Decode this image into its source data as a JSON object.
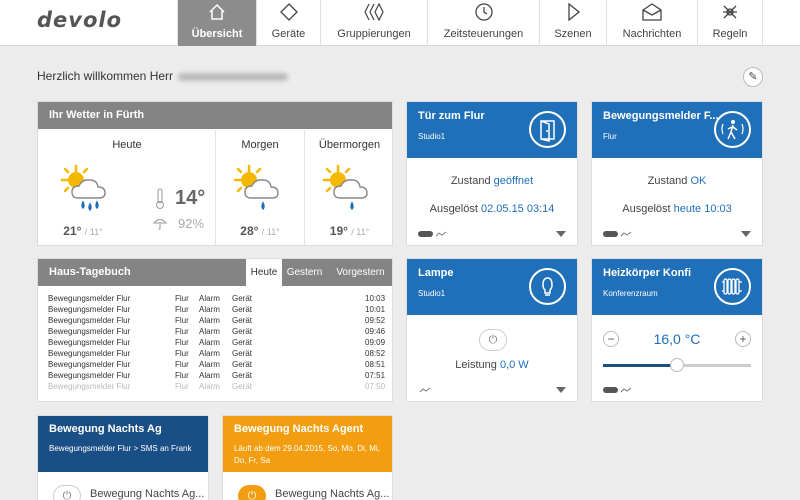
{
  "brand": {
    "logo": "devolo"
  },
  "nav": {
    "tabs": [
      {
        "label": "Übersicht",
        "icon": "home-icon"
      },
      {
        "label": "Geräte",
        "icon": "diamond-icon"
      },
      {
        "label": "Gruppierungen",
        "icon": "groups-icon"
      },
      {
        "label": "Zeitsteuerungen",
        "icon": "clock-icon"
      },
      {
        "label": "Szenen",
        "icon": "play-icon"
      },
      {
        "label": "Nachrichten",
        "icon": "envelope-icon"
      },
      {
        "label": "Regeln",
        "icon": "rules-icon"
      }
    ],
    "active_index": 0
  },
  "greeting": {
    "text": "Herzlich willkommen Herr"
  },
  "weather": {
    "title": "Ihr Wetter in Fürth",
    "days": [
      {
        "label": "Heute",
        "icon": "sun-cloud-rain-icon",
        "temp": "21°",
        "low": "/ 11°"
      },
      {
        "label": "Morgen",
        "icon": "sun-cloud-rain-icon",
        "temp": "28°",
        "low": "/ 11°"
      },
      {
        "label": "Übermorgen",
        "icon": "sun-cloud-rain-icon",
        "temp": "19°",
        "low": "/ 11°"
      }
    ],
    "current_temp": "14°",
    "humidity": "92%"
  },
  "tiles": {
    "door": {
      "title": "Tür zum Flur",
      "subtitle": "Studio1",
      "state_label": "Zustand",
      "state_value": "geöffnet",
      "trigger_label": "Ausgelöst",
      "trigger_value": "02.05.15 03:14",
      "icon": "door-icon"
    },
    "motion": {
      "title": "Bewegungsmelder F...",
      "subtitle": "Flur",
      "state_label": "Zustand",
      "state_value": "OK",
      "trigger_label": "Ausgelöst",
      "trigger_value": "heute 10:03",
      "icon": "motion-person-icon"
    },
    "lamp": {
      "title": "Lampe",
      "subtitle": "Studio1",
      "power_label": "Leistung",
      "power_value": "0,0 W",
      "icon": "bulb-icon"
    },
    "heater": {
      "title": "Heizkörper Konfi",
      "subtitle": "Konferenzraum",
      "setpoint": "16,0 °C",
      "slider_fraction": 0.5,
      "icon": "radiator-icon"
    }
  },
  "diary": {
    "title": "Haus-Tagebuch",
    "tabs": [
      "Heute",
      "Gestern",
      "Vorgestern"
    ],
    "active_tab": 0,
    "rows": [
      {
        "device": "Bewegungsmelder Flur",
        "room": "Flur",
        "type": "Alarm",
        "src": "Gerät",
        "time": "10:03"
      },
      {
        "device": "Bewegungsmelder Flur",
        "room": "Flur",
        "type": "Alarm",
        "src": "Gerät",
        "time": "10:01"
      },
      {
        "device": "Bewegungsmelder Flur",
        "room": "Flur",
        "type": "Alarm",
        "src": "Gerät",
        "time": "09:52"
      },
      {
        "device": "Bewegungsmelder Flur",
        "room": "Flur",
        "type": "Alarm",
        "src": "Gerät",
        "time": "09:46"
      },
      {
        "device": "Bewegungsmelder Flur",
        "room": "Flur",
        "type": "Alarm",
        "src": "Gerät",
        "time": "09:09"
      },
      {
        "device": "Bewegungsmelder Flur",
        "room": "Flur",
        "type": "Alarm",
        "src": "Gerät",
        "time": "08:52"
      },
      {
        "device": "Bewegungsmelder Flur",
        "room": "Flur",
        "type": "Alarm",
        "src": "Gerät",
        "time": "08:51"
      },
      {
        "device": "Bewegungsmelder Flur",
        "room": "Flur",
        "type": "Alarm",
        "src": "Gerät",
        "time": "07:51"
      },
      {
        "device": "Bewegungsmelder Flur",
        "room": "Flur",
        "type": "Alarm",
        "src": "Gerät",
        "time": "07:50"
      }
    ]
  },
  "rules": [
    {
      "title": "Bewegung Nachts Ag",
      "subtitle": "Bewegungsmelder Flur > SMS an Frank",
      "row_label": "Bewegung Nachts Ag..."
    },
    {
      "title": "Bewegung Nachts Agent",
      "subtitle": "Läuft ab dem 29.04.2015, So, Mo, Di, Mi, Do, Fr, Sa",
      "row_label": "Bewegung Nachts Ag..."
    }
  ],
  "colors": {
    "blue": "#1f70b8",
    "gray": "#848484",
    "navy": "#1a4f86",
    "orange": "#f39d11"
  }
}
